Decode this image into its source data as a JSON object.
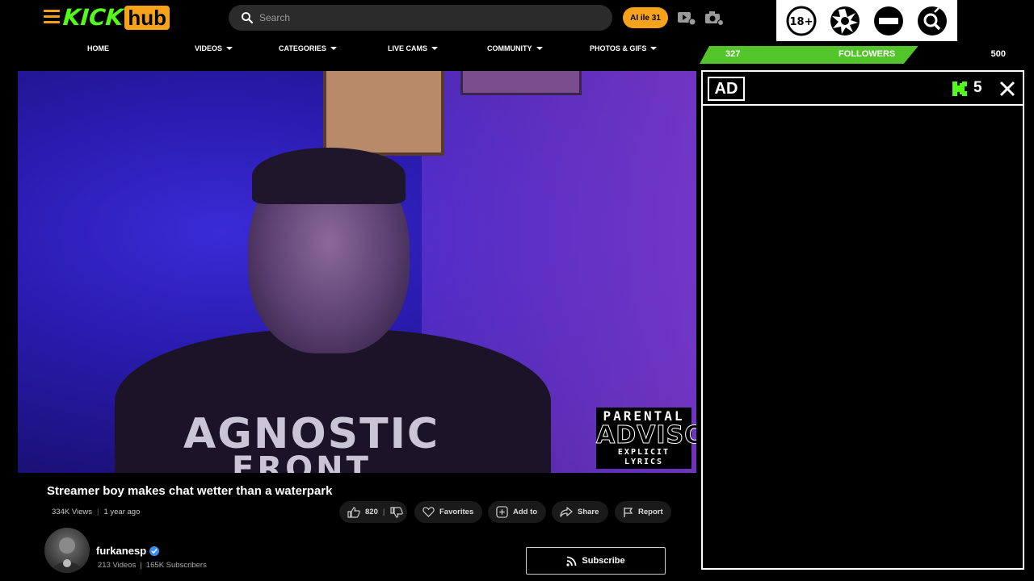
{
  "header": {
    "logo_primary": "KICK",
    "logo_secondary": "hub",
    "search_placeholder": "Search",
    "ai_button_label": "AI ile 31"
  },
  "nav": {
    "items": [
      {
        "label": "HOME",
        "has_caret": false
      },
      {
        "label": "VIDEOS",
        "has_caret": true
      },
      {
        "label": "CATEGORIES",
        "has_caret": true
      },
      {
        "label": "LIVE CAMS",
        "has_caret": true
      },
      {
        "label": "COMMUNITY",
        "has_caret": true
      },
      {
        "label": "PHOTOS & GIFS",
        "has_caret": true
      }
    ]
  },
  "badges": [
    "18-plus-icon",
    "explosion-icon",
    "no-entry-icon",
    "gender-search-icon"
  ],
  "followers": {
    "current": "327",
    "label": "FOLLOWERS",
    "goal": "500",
    "progress": 0.654,
    "color": "#53c42a"
  },
  "video": {
    "shirt_text_line1": "AGNOSTIC",
    "shirt_text_line2": "FRONT",
    "advisory_line1": "PARENTAL",
    "advisory_line2": "ADVISORY",
    "advisory_line3": "EXPLICIT LYRICS",
    "title": "Streamer boy makes chat wetter than a waterpark",
    "views": "334K Views",
    "posted": "1 year ago",
    "separator": "|"
  },
  "actions": {
    "likes": "820",
    "favorites_label": "Favorites",
    "add_to_label": "Add to",
    "share_label": "Share",
    "report_label": "Report"
  },
  "channel": {
    "name": "furkanesp",
    "videos": "213 Videos",
    "subscribers": "165K Subscribers",
    "separator": "|",
    "subscribe_label": "Subscribe"
  },
  "ad": {
    "label": "AD",
    "timer": "5"
  },
  "colors": {
    "brand_green": "#53fc18",
    "brand_orange": "#f7a21b",
    "verified_blue": "#3b8ff0"
  }
}
